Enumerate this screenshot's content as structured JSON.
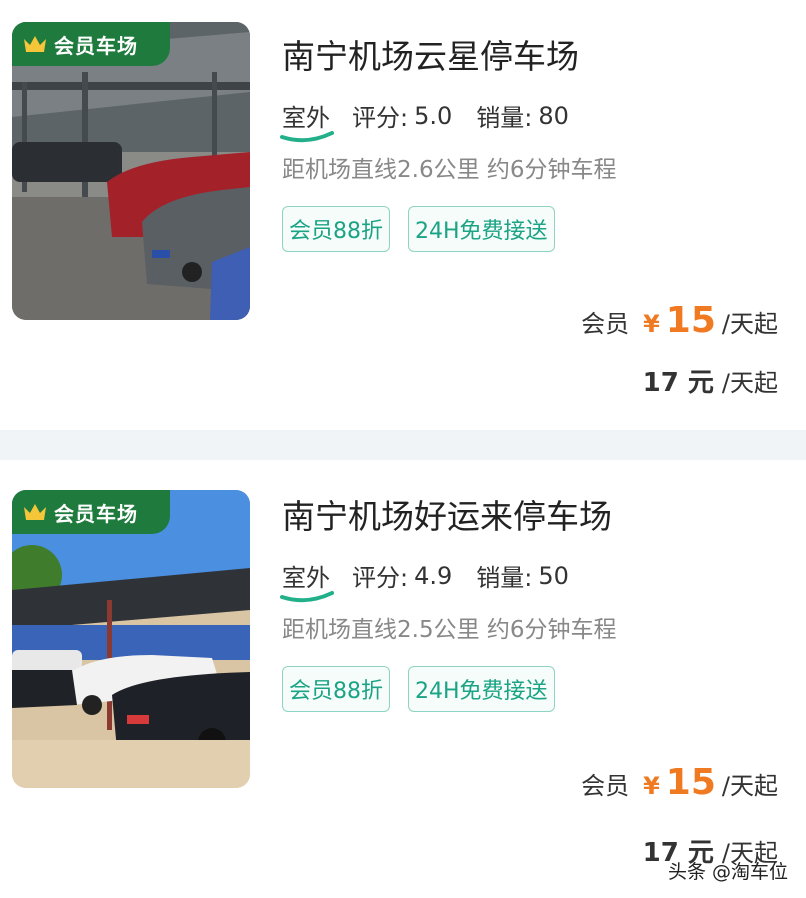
{
  "listings": [
    {
      "badge": "会员车场",
      "title": "南宁机场云星停车场",
      "type": "室外",
      "rating_label": "评分:",
      "rating": "5.0",
      "sales_label": "销量:",
      "sales": "80",
      "distance": "距机场直线2.6公里 约6分钟车程",
      "tags": [
        "会员88折",
        "24H免费接送"
      ],
      "member_label": "会员",
      "currency": "¥",
      "member_price": "15",
      "price_unit": "/天起",
      "normal_price": "17 元",
      "normal_unit": "/天起"
    },
    {
      "badge": "会员车场",
      "title": "南宁机场好运来停车场",
      "type": "室外",
      "rating_label": "评分:",
      "rating": "4.9",
      "sales_label": "销量:",
      "sales": "50",
      "distance": "距机场直线2.5公里 约6分钟车程",
      "tags": [
        "会员88折",
        "24H免费接送"
      ],
      "member_label": "会员",
      "currency": "¥",
      "member_price": "15",
      "price_unit": "/天起",
      "normal_price": "17 元",
      "normal_unit": "/天起"
    }
  ],
  "watermark": "头条 @淘车位",
  "colors": {
    "badge_bg": "#1f7a3d",
    "tag_text": "#1aa384",
    "tag_border": "#8fd3c3",
    "price": "#f07a22"
  }
}
